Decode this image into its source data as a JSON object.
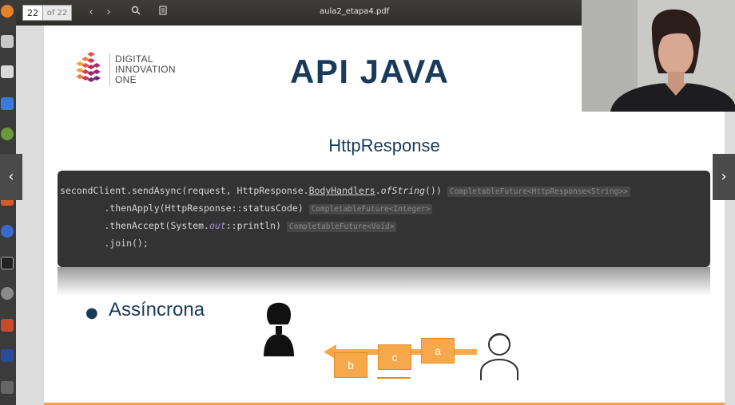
{
  "toolbar": {
    "page_current": "22",
    "page_total": "of 22",
    "doc_title": "aula2_etapa4.pdf",
    "icons": [
      "chevron-left-icon",
      "chevron-right-icon",
      "search-icon",
      "document-icon"
    ]
  },
  "slide": {
    "logo_line1": "DIGITAL",
    "logo_line2": "INNOVATION",
    "logo_line3": "ONE",
    "title": "API JAVA",
    "subtitle": "HttpResponse",
    "code": {
      "line1_a": "secondClient.sendAsync(request, HttpResponse.",
      "line1_b": "BodyHandlers",
      "line1_c": ".",
      "line1_d": "ofString",
      "line1_e": "())",
      "line1_hint": "CompletableFuture<HttpResponse<String>>",
      "line2_a": "        .thenApply(HttpResponse::statusCode)",
      "line2_hint": "CompletableFuture<Integer>",
      "line3_a": "        .thenAccept(System.",
      "line3_b": "out",
      "line3_c": "::println)",
      "line3_hint": "CompletableFuture<Void>",
      "line4_a": "        .join();"
    },
    "bullet": "Assíncrona",
    "packets": [
      "b",
      "c",
      "a"
    ]
  },
  "colors": {
    "title": "#1a3a5c",
    "code_bg": "#333333",
    "accent_orange": "#f7a84a"
  }
}
